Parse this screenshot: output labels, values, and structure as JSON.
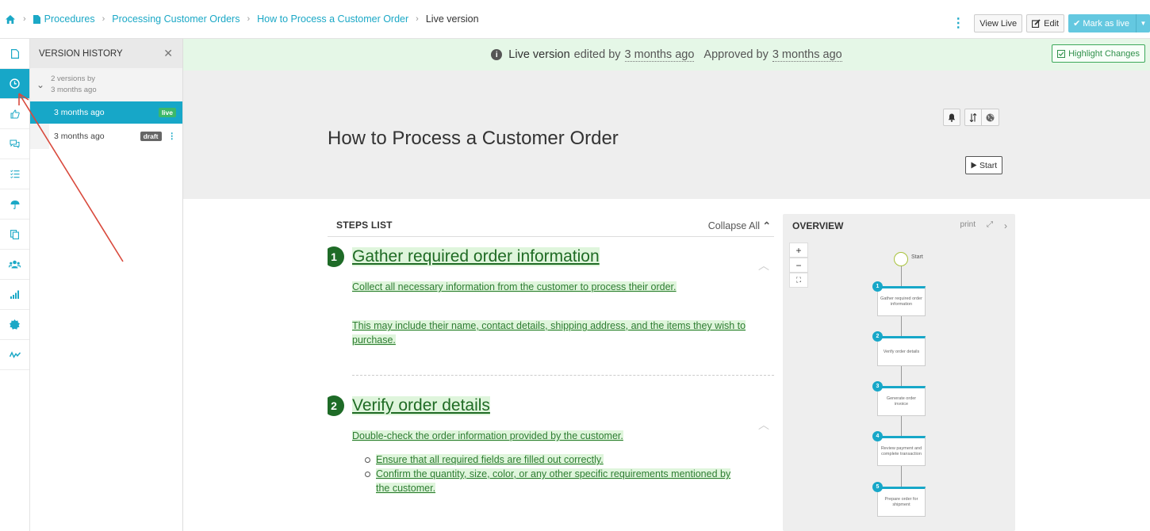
{
  "breadcrumb": {
    "items": [
      "Procedures",
      "Processing Customer Orders",
      "How to Process a Customer Order"
    ],
    "current": "Live version"
  },
  "toolbar": {
    "view_live": "View Live",
    "edit": "Edit",
    "mark_as_live": "Mark as live"
  },
  "version_history": {
    "title": "VERSION HISTORY",
    "group_line1": "2 versions by",
    "group_line2": "3 months ago",
    "versions": [
      {
        "time": "3 months ago",
        "badge": "live"
      },
      {
        "time": "3 months ago",
        "badge": "draft"
      }
    ]
  },
  "banner": {
    "live_version": "Live version",
    "edited_by": "edited by",
    "edited_time": "3 months ago",
    "approved_by": "Approved by",
    "approved_time": "3 months ago",
    "highlight_changes": "Highlight Changes"
  },
  "procedure": {
    "title": "How to Process a Customer Order",
    "start": "Start"
  },
  "steps_list": {
    "label": "STEPS LIST",
    "collapse_all": "Collapse All",
    "steps": [
      {
        "number": "1",
        "title": "Gather required order information",
        "paragraphs": [
          "Collect all necessary information from the customer to process their order.",
          "This may include their name, contact details, shipping address, and the items they wish to purchase."
        ]
      },
      {
        "number": "2",
        "title": "Verify order details",
        "paragraphs": [
          "Double-check the order information provided by the customer."
        ],
        "bullets": [
          "Ensure that all required fields are filled out correctly.",
          "Confirm the quantity, size, color, or any other specific requirements mentioned by the customer."
        ]
      }
    ]
  },
  "overview": {
    "label": "OVERVIEW",
    "print": "print",
    "start_label": "Start",
    "nodes": [
      {
        "number": "1",
        "label": "Gather required order information"
      },
      {
        "number": "2",
        "label": "Verify order details"
      },
      {
        "number": "3",
        "label": "Generate order invoice"
      },
      {
        "number": "4",
        "label": "Review payment and complete transaction"
      },
      {
        "number": "5",
        "label": "Prepare order for shipment"
      }
    ]
  },
  "colors": {
    "accent": "#17a7c8",
    "step_green": "#1e6b27",
    "highlight_green": "#dff5dc",
    "banner_bg": "#e5f7e7",
    "annotation_arrow": "#d94a3d"
  }
}
